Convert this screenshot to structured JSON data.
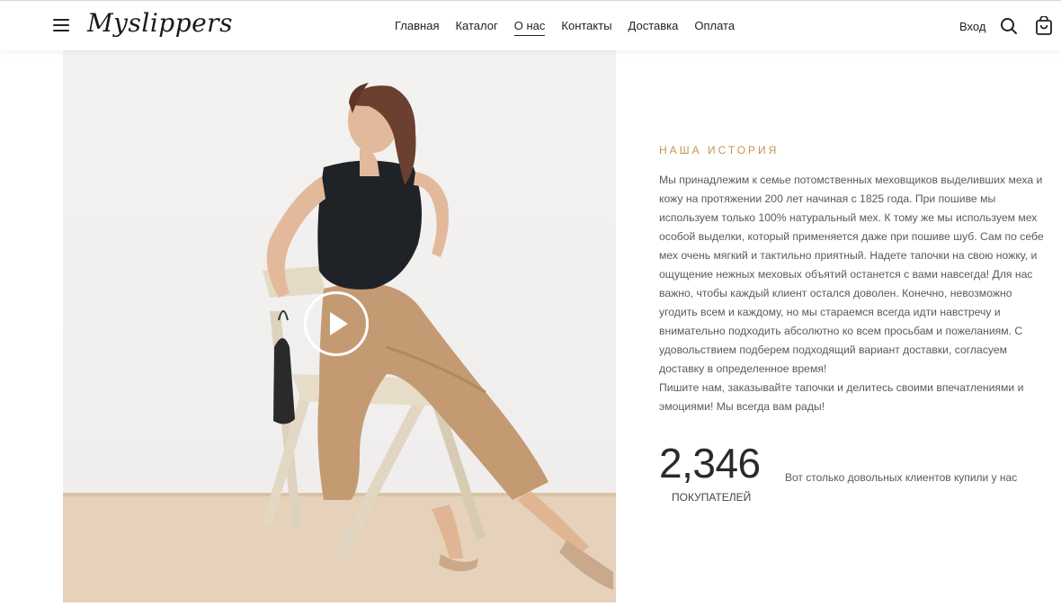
{
  "header": {
    "logo": "Myslippers",
    "nav": [
      {
        "label": "Главная",
        "active": false
      },
      {
        "label": "Каталог",
        "active": false
      },
      {
        "label": "О нас",
        "active": true
      },
      {
        "label": "Контакты",
        "active": false
      },
      {
        "label": "Доставка",
        "active": false
      },
      {
        "label": "Оплата",
        "active": false
      }
    ],
    "login_label": "Вход",
    "icons": {
      "menu": "hamburger-icon",
      "search": "search-icon",
      "cart": "cart-icon"
    }
  },
  "media": {
    "play_icon": "play-icon"
  },
  "story": {
    "eyebrow": "НАША ИСТОРИЯ",
    "text": "Мы принадлежим к семье потомственных меховщиков выделивших меха и кожу на протяжении 200 лет начиная с 1825 года. При пошиве мы используем только 100% натуральный мех. К тому же мы используем мех особой выделки, который применяется даже при пошиве шуб. Сам по себе мех очень мягкий и тактильно приятный. Надете тапочки на свою ножку, и ощущение нежных меховых объятий останется с вами навсегда! Для нас важно, чтобы каждый клиент остался доволен. Конечно, невозможно угодить всем и каждому, но мы стараемся всегда идти навстречу и внимательно подходить абсолютно ко всем просьбам и пожеланиям. С удовольствием подберем подходящий вариант доставки, согласуем доставку в определенное время!",
    "text2": "Пишите нам, заказывайте тапочки и делитесь своими впечатлениями и эмоциями! Мы всегда вам рады!"
  },
  "stats": {
    "number": "2,346",
    "unit": "ПОКУПАТЕЛЕЙ",
    "caption": "Вот столько довольных клиентов купили у нас"
  },
  "colors": {
    "accent": "#c4964f",
    "text": "#222222",
    "muted": "#5a5a5a"
  }
}
